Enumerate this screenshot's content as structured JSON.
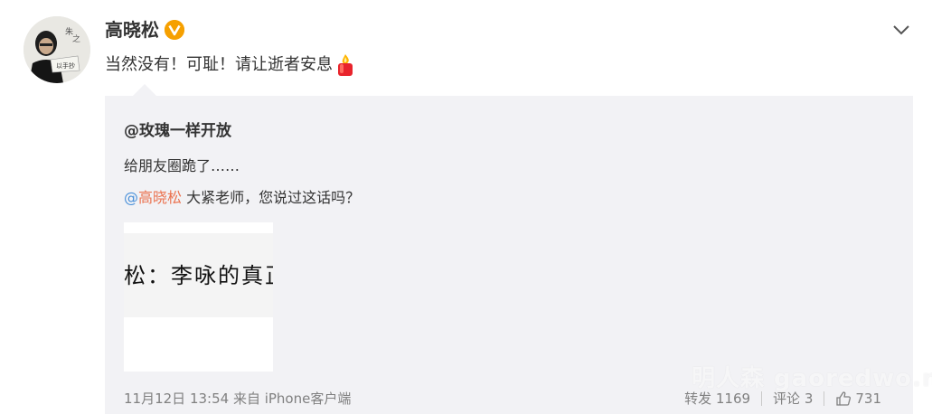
{
  "post": {
    "author": "高晓松",
    "text": "当然没有！可耻！请让逝者安息",
    "badge_icon": "verified-v-icon",
    "emoji_icon": "candle-icon"
  },
  "quote": {
    "author": "@玫瑰一样开放",
    "text1": "给朋友圈跪了……",
    "mention": "高晓松",
    "text2_rest": " 大紧老师，您说过这话吗？",
    "image_text": "松：李咏的真正"
  },
  "footer": {
    "meta": "11月12日 13:54 来自 iPhone客户端",
    "repost": "转发 1169",
    "comment": "评论 3",
    "like": "731"
  },
  "watermark": "明人森 gaoredwo.net",
  "colors": {
    "quote_bg": "#f2f2f5",
    "mention_name": "#eb7350",
    "mention_at": "#4a90d9",
    "badge": "#f6a000",
    "meta_text": "#808080"
  }
}
